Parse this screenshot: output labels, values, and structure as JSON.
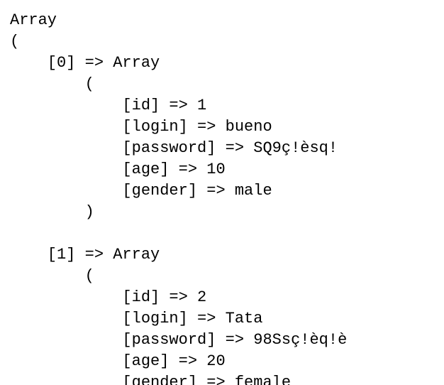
{
  "lines": [
    "Array",
    "(",
    "    [0] => Array",
    "        (",
    "            [id] => 1",
    "            [login] => bueno",
    "            [password] => SQ9ç!èsq!",
    "            [age] => 10",
    "            [gender] => male",
    "        )",
    "",
    "    [1] => Array",
    "        (",
    "            [id] => 2",
    "            [login] => Tata",
    "            [password] => 98Ssç!èq!è",
    "            [age] => 20",
    "            [gender] => female"
  ]
}
